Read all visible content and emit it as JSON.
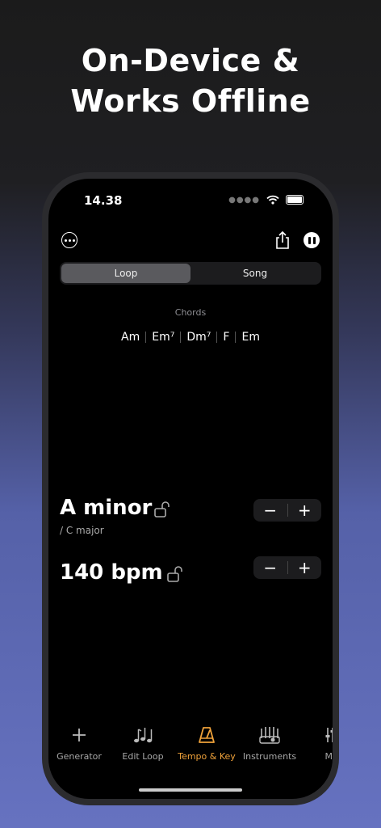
{
  "headline": [
    "On-Device &",
    "Works Offline"
  ],
  "status": {
    "time": "14.38"
  },
  "segment": {
    "options": [
      "Loop",
      "Song"
    ],
    "selected": 0
  },
  "chords": {
    "title": "Chords",
    "items": [
      "Am",
      "Em⁷",
      "Dm⁷",
      "F",
      "Em"
    ]
  },
  "key": {
    "value": "A minor",
    "relative": "/ C major",
    "locked": false
  },
  "tempo": {
    "value": "140 bpm",
    "locked": false
  },
  "stepper": {
    "minus": "−",
    "plus": "+"
  },
  "tabs": [
    {
      "label": "Generator",
      "icon": "plus-icon",
      "active": false
    },
    {
      "label": "Edit Loop",
      "icon": "music-notes-icon",
      "active": false
    },
    {
      "label": "Tempo & Key",
      "icon": "metronome-icon",
      "active": true
    },
    {
      "label": "Instruments",
      "icon": "instruments-icon",
      "active": false
    },
    {
      "label": "Mix",
      "icon": "sliders-icon",
      "active": false
    }
  ],
  "colors": {
    "accent": "#f0a23a",
    "segment_active": "#5a5a5e",
    "screen_bg": "#000000"
  }
}
